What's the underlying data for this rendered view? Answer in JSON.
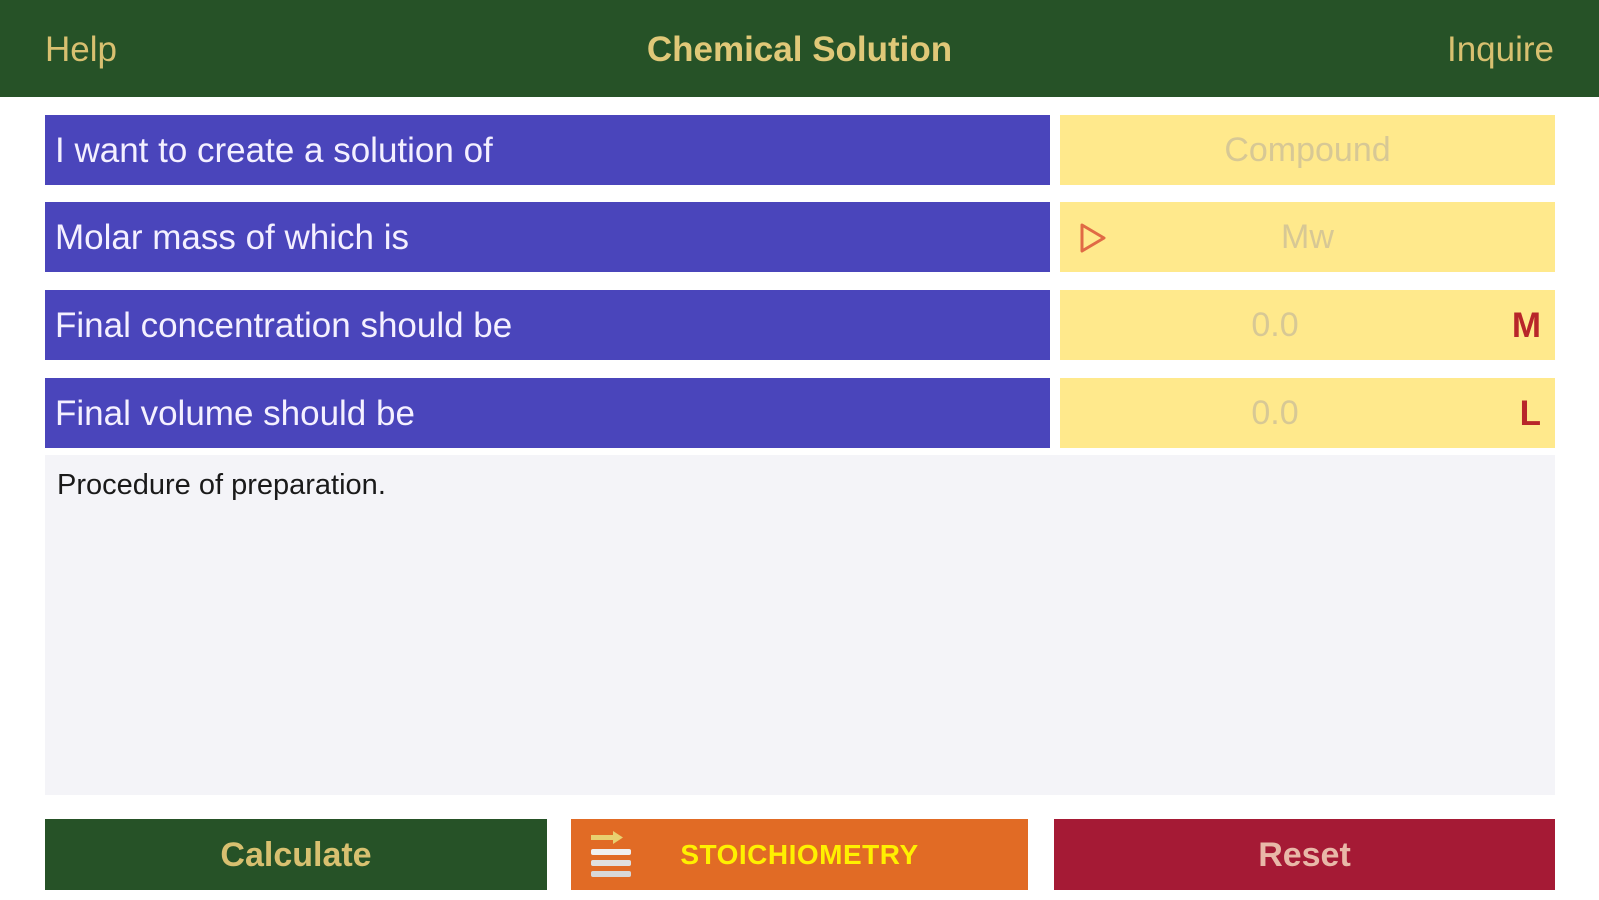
{
  "navbar": {
    "left_label": "Help",
    "title": "Chemical Solution",
    "right_label": "Inquire"
  },
  "form": {
    "rows": [
      {
        "label": "I want to create a solution of",
        "placeholder": "Compound",
        "unit": ""
      },
      {
        "label": "Molar mass of which is",
        "placeholder": "Mw",
        "unit": "",
        "icon": "play-triangle-icon"
      },
      {
        "label": "Final concentration should be",
        "placeholder": "0.0",
        "unit": "M"
      },
      {
        "label": "Final volume should be",
        "placeholder": "0.0",
        "unit": "L"
      }
    ]
  },
  "procedure": {
    "text": "Procedure of preparation."
  },
  "buttons": {
    "calculate": "Calculate",
    "stoichiometry": "STOICHIOMETRY",
    "reset": "Reset"
  },
  "colors": {
    "navbar": "#265227",
    "label_bg": "#4a45bb",
    "field_bg": "#ffe98c",
    "unit": "#b8262a",
    "calculate": "#265227",
    "stoichiometry": "#e16b25",
    "reset": "#a51a35"
  }
}
